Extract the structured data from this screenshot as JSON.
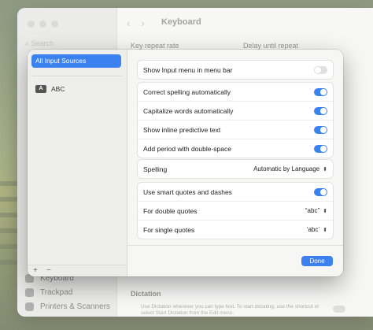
{
  "window": {
    "title": "Keyboard",
    "search_placeholder": "Search",
    "sidebar_bottom": [
      "Keyboard",
      "Trackpad",
      "Printers & Scanners"
    ],
    "bg_labels": {
      "key_repeat": "Key repeat rate",
      "delay": "Delay until repeat",
      "dictation": "Dictation",
      "dictation_desc": "Use Dictation wherever you can type text. To start dictating, use the shortcut or select Start Dictation from the Edit menu."
    }
  },
  "sheet": {
    "sources": {
      "selected": "All Input Sources",
      "items": [
        {
          "badge": "A",
          "label": "ABC"
        }
      ],
      "add": "+",
      "remove": "−"
    },
    "group1": [
      {
        "label": "Show Input menu in menu bar",
        "on": false
      }
    ],
    "group2": [
      {
        "label": "Correct spelling automatically",
        "on": true
      },
      {
        "label": "Capitalize words automatically",
        "on": true
      },
      {
        "label": "Show inline predictive text",
        "on": true
      },
      {
        "label": "Add period with double-space",
        "on": true
      }
    ],
    "spelling": {
      "label": "Spelling",
      "value": "Automatic by Language"
    },
    "quotes": [
      {
        "label": "Use smart quotes and dashes",
        "on": true
      },
      {
        "label": "For double quotes",
        "value": "“abc”"
      },
      {
        "label": "For single quotes",
        "value": "‘abc’"
      }
    ],
    "done_label": "Done"
  },
  "colors": {
    "accent": "#3b82f0"
  }
}
